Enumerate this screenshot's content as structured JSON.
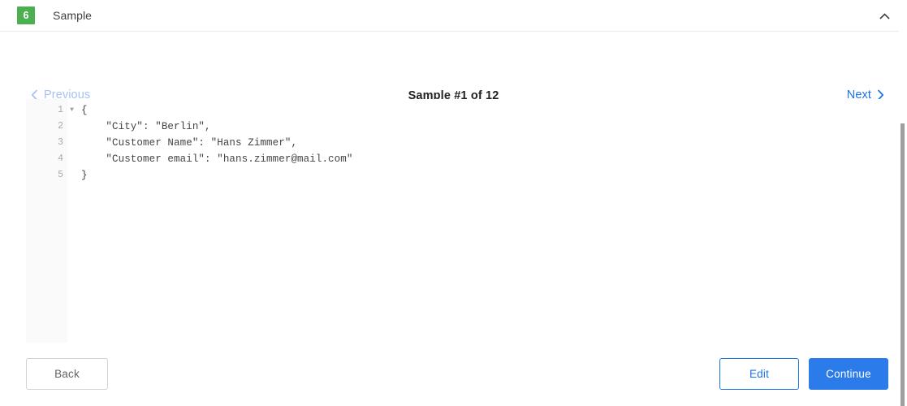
{
  "header": {
    "step_number": "6",
    "title": "Sample",
    "collapse_icon": "chevron-up-icon"
  },
  "navigation": {
    "previous_label": "Previous",
    "previous_icon": "chevron-left-icon",
    "previous_color": "#a7c1f5",
    "next_label": "Next",
    "next_icon": "chevron-right-icon",
    "next_color": "#1a73e8",
    "counter": "Sample #1 of 12"
  },
  "editor": {
    "fold_marker": "▼",
    "lines": [
      {
        "number": "1",
        "text": "{",
        "foldable": true
      },
      {
        "number": "2",
        "text": "    \"City\": \"Berlin\",",
        "foldable": false
      },
      {
        "number": "3",
        "text": "    \"Customer Name\": \"Hans Zimmer\",",
        "foldable": false
      },
      {
        "number": "4",
        "text": "    \"Customer email\": \"hans.zimmer@mail.com\"",
        "foldable": false
      },
      {
        "number": "5",
        "text": "}",
        "foldable": false
      }
    ]
  },
  "footer": {
    "back_label": "Back",
    "edit_label": "Edit",
    "continue_label": "Continue"
  },
  "colors": {
    "badge_green": "#4caf50",
    "primary_blue": "#2b7cea",
    "link_blue": "#1a73e8",
    "gutter_bg": "#fafafa"
  }
}
